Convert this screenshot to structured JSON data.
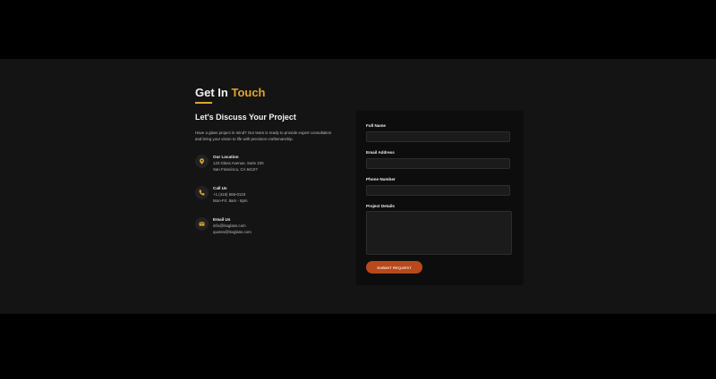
{
  "section": {
    "heading_main": "Get In",
    "heading_accent": "Touch",
    "subheading": "Let's Discuss Your Project",
    "intro": "Have a glass project in mind? Our team is ready to provide expert consultation and bring your vision to life with precision craftsmanship."
  },
  "contacts": [
    {
      "icon": "location-pin-icon",
      "title": "Our Location",
      "lines": [
        "123 Glass Avenue, Suite 100",
        "San Francisco, CA 94107"
      ]
    },
    {
      "icon": "phone-icon",
      "title": "Call Us",
      "lines": [
        "+1 (415) 555-0123",
        "Mon-Fri: 8am - 6pm"
      ]
    },
    {
      "icon": "envelope-icon",
      "title": "Email Us",
      "lines": [
        "info@lsxglass.com",
        "quotes@lsxglass.com"
      ]
    }
  ],
  "form": {
    "full_name_label": "Full Name",
    "full_name_value": "",
    "email_label": "Email Address",
    "email_value": "",
    "phone_label": "Phone Number",
    "phone_value": "",
    "details_label": "Project Details",
    "details_value": "",
    "submit_label": "SUBMIT REQUEST"
  },
  "colors": {
    "page_background": "#000000",
    "section_background": "#141414",
    "card_background": "#0d0d0d",
    "accent": "#e0a52f",
    "button": "#b9491a"
  }
}
